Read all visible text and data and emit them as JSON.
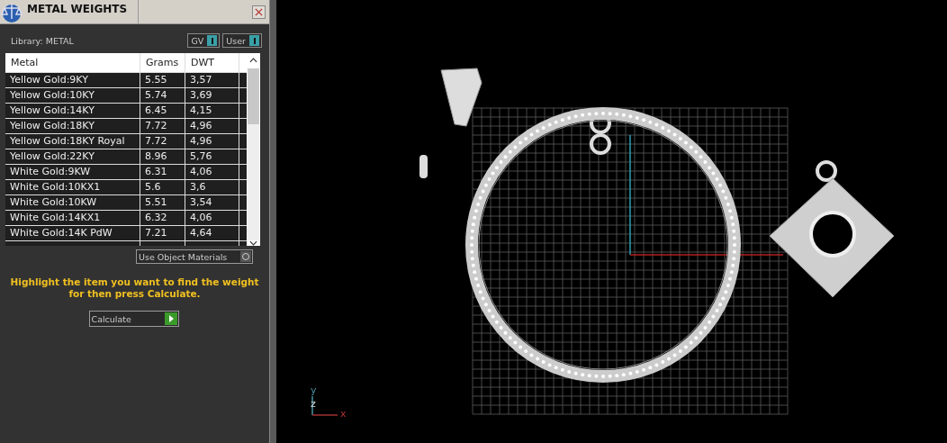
{
  "panel": {
    "title": "METAL WEIGHTS",
    "library": "Library: METAL",
    "toggles": [
      {
        "label": "GV",
        "on": true
      },
      {
        "label": "User",
        "on": true
      }
    ],
    "table": {
      "columns": [
        "Metal",
        "Grams",
        "DWT"
      ],
      "rows": [
        [
          "Yellow Gold:9KY",
          "5.55",
          "3,57"
        ],
        [
          "Yellow Gold:10KY",
          "5.74",
          "3,69"
        ],
        [
          "Yellow Gold:14KY",
          "6.45",
          "4,15"
        ],
        [
          "Yellow Gold:18KY",
          "7.72",
          "4,96"
        ],
        [
          "Yellow Gold:18KY Royal",
          "7.72",
          "4,96"
        ],
        [
          "Yellow Gold:22KY",
          "8.96",
          "5,76"
        ],
        [
          "White Gold:9KW",
          "6.31",
          "4,06"
        ],
        [
          "White Gold:10KX1",
          "5.6",
          "3,6"
        ],
        [
          "White Gold:10KW",
          "5.51",
          "3,54"
        ],
        [
          "White Gold:14KX1",
          "6.32",
          "4,06"
        ],
        [
          "White Gold:14K PdW",
          "7.21",
          "4,64"
        ]
      ]
    },
    "use_object_materials": {
      "label": "Use Object Materials",
      "checked": false
    },
    "hint": "Highlight the item you want to find the weight for then press Calculate.",
    "calculate": "Calculate"
  },
  "viewport": {
    "axes": [
      "y",
      "z",
      "x"
    ]
  }
}
